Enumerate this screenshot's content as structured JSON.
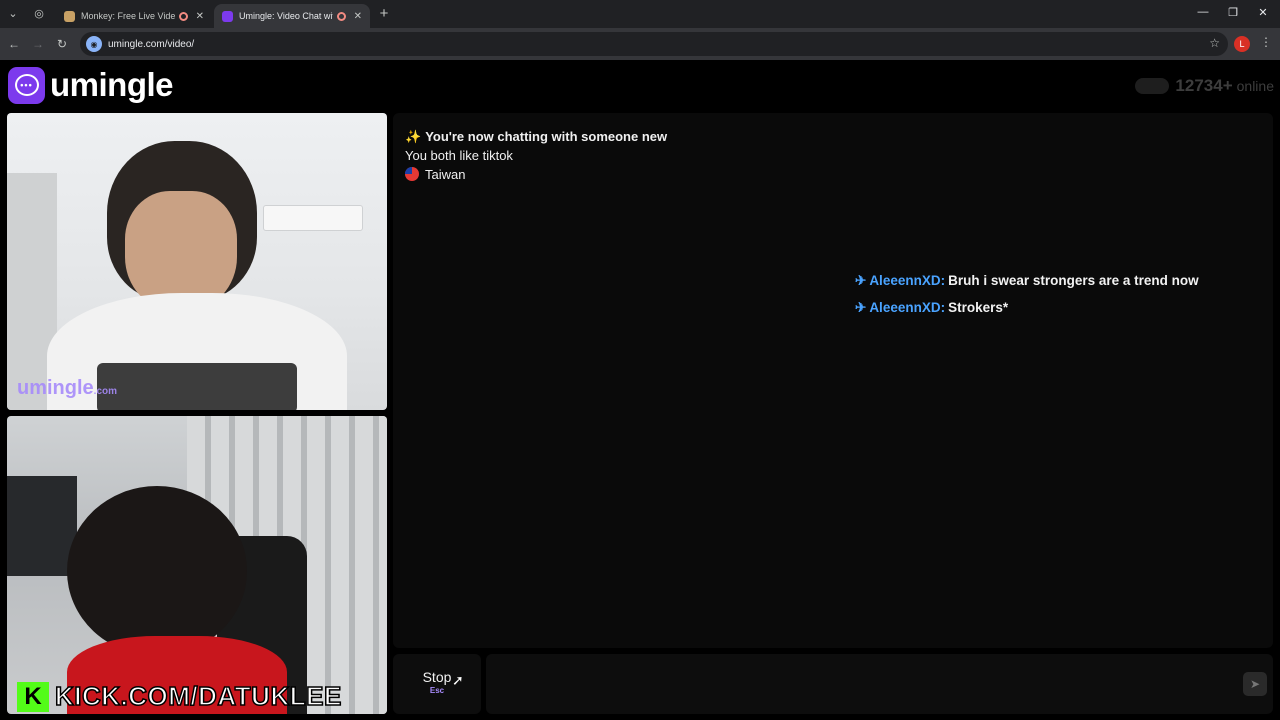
{
  "browser": {
    "tabs": [
      {
        "title": "Monkey: Free Live Video Chat",
        "active": false
      },
      {
        "title": "Umingle: Video Chat with Strangers",
        "active": true
      }
    ],
    "new_tab_icon": "+",
    "url": "umingle.com/video/",
    "profile_initial": "L"
  },
  "header": {
    "logo_text": "umingle",
    "online_count": "12734+",
    "online_label": "online"
  },
  "videos": {
    "stranger_watermark": "umingle",
    "stranger_watermark_suffix": ".com",
    "self_overlay_text": "KICK.COM/DATUKLEE",
    "self_overlay_logo": "K"
  },
  "chat": {
    "system_messages": [
      {
        "icon": "sparkles",
        "text": "You're now chatting with someone new",
        "bold": true
      },
      {
        "icon": "",
        "text": "You both like tiktok",
        "bold": false
      },
      {
        "icon": "taiwan-flag",
        "text": "Taiwan",
        "bold": false
      }
    ],
    "messages": [
      {
        "nick": "AleeennXD:",
        "text": "Bruh i swear strongers are a trend now"
      },
      {
        "nick": "AleeennXD:",
        "text": "Strokers*"
      }
    ]
  },
  "controls": {
    "stop_label": "Stop",
    "stop_shortcut": "Esc",
    "input_placeholder": "",
    "send_icon": "send-icon"
  },
  "colors": {
    "brand": "#7c3aed",
    "nick": "#4aa3ff",
    "kick_green": "#53fc18"
  }
}
